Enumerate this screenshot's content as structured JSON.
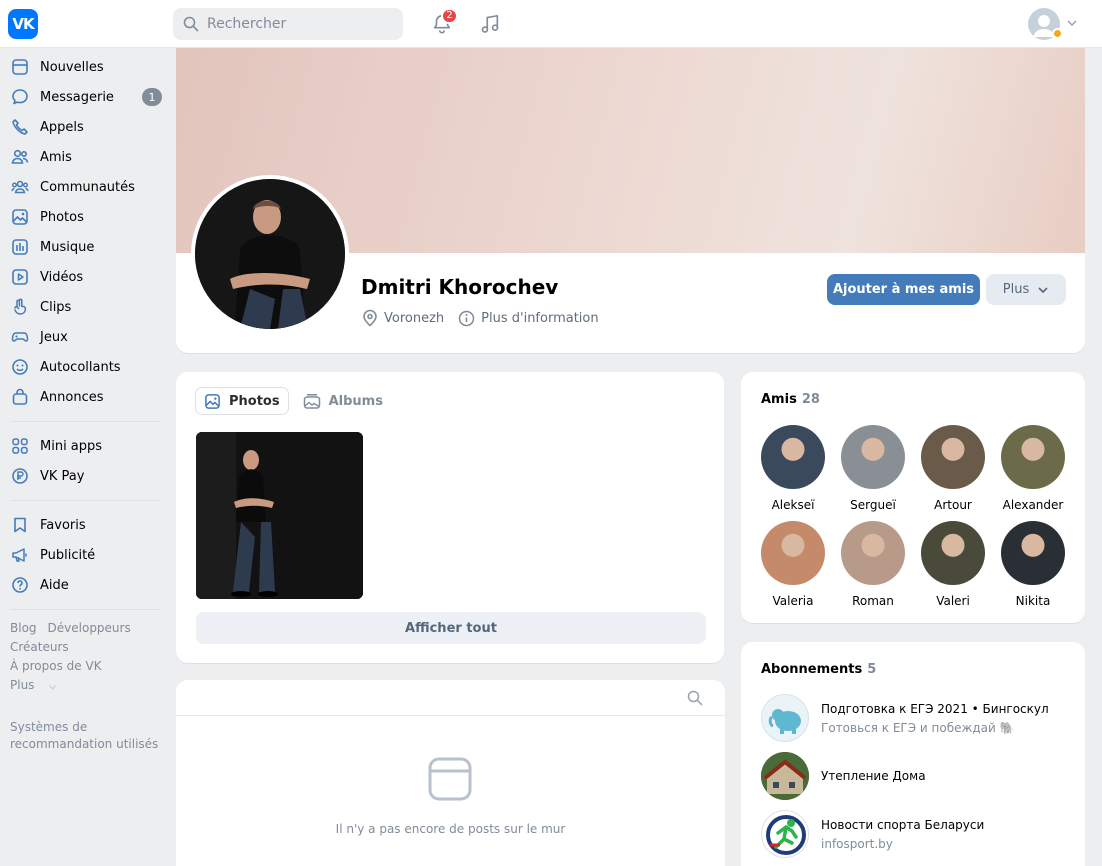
{
  "header": {
    "logo_text": "VK",
    "search_placeholder": "Rechercher",
    "notifications_count": "2"
  },
  "sidebar": {
    "items": [
      {
        "label": "Nouvelles",
        "icon": "news-icon"
      },
      {
        "label": "Messagerie",
        "icon": "message-icon",
        "badge": "1"
      },
      {
        "label": "Appels",
        "icon": "phone-icon"
      },
      {
        "label": "Amis",
        "icon": "friends-icon"
      },
      {
        "label": "Communautés",
        "icon": "communities-icon"
      },
      {
        "label": "Photos",
        "icon": "photo-icon"
      },
      {
        "label": "Musique",
        "icon": "music-icon"
      },
      {
        "label": "Vidéos",
        "icon": "video-icon"
      },
      {
        "label": "Clips",
        "icon": "clips-icon"
      },
      {
        "label": "Jeux",
        "icon": "gamepad-icon"
      },
      {
        "label": "Autocollants",
        "icon": "sticker-icon"
      },
      {
        "label": "Annonces",
        "icon": "bag-icon"
      }
    ],
    "items2": [
      {
        "label": "Mini apps",
        "icon": "apps-icon"
      },
      {
        "label": "VK Pay",
        "icon": "pay-icon"
      }
    ],
    "items3": [
      {
        "label": "Favoris",
        "icon": "bookmark-icon"
      },
      {
        "label": "Publicité",
        "icon": "megaphone-icon"
      },
      {
        "label": "Aide",
        "icon": "help-icon"
      }
    ],
    "footer": {
      "blog": "Blog",
      "developers": "Développeurs",
      "creators": "Créateurs",
      "about": "À propos de VK",
      "more": "Plus",
      "recommendations": "Systèmes de recommandation utilisés"
    }
  },
  "profile": {
    "name": "Dmitri Khorochev",
    "city": "Voronezh",
    "more_info": "Plus d'information",
    "add_friend": "Ajouter à mes amis",
    "more_button": "Plus"
  },
  "photos": {
    "tab_photos": "Photos",
    "tab_albums": "Albums",
    "show_all": "Afficher tout"
  },
  "friends": {
    "title": "Amis",
    "count": "28",
    "list": [
      {
        "name": "Alekseï",
        "color": "#3a4a5c"
      },
      {
        "name": "Sergueï",
        "color": "#8a8f96"
      },
      {
        "name": "Artour",
        "color": "#6a5a4a"
      },
      {
        "name": "Alexander",
        "color": "#6b6b4a"
      },
      {
        "name": "Valeria",
        "color": "#c48a6a"
      },
      {
        "name": "Roman",
        "color": "#b89a88"
      },
      {
        "name": "Valeri",
        "color": "#4a4a3a"
      },
      {
        "name": "Nikita",
        "color": "#2a2e35"
      }
    ]
  },
  "subscriptions": {
    "title": "Abonnements",
    "count": "5",
    "list": [
      {
        "title": "Подготовка к ЕГЭ 2021 • Бингоскул",
        "subtitle": "Готовься к ЕГЭ и побеждай 🐘"
      },
      {
        "title": "Утепление Дома",
        "subtitle": ""
      },
      {
        "title": "Новости спорта Беларуси",
        "subtitle": "infosport.by"
      }
    ]
  },
  "wall": {
    "empty": "Il n'y a pas encore de posts sur le mur"
  }
}
